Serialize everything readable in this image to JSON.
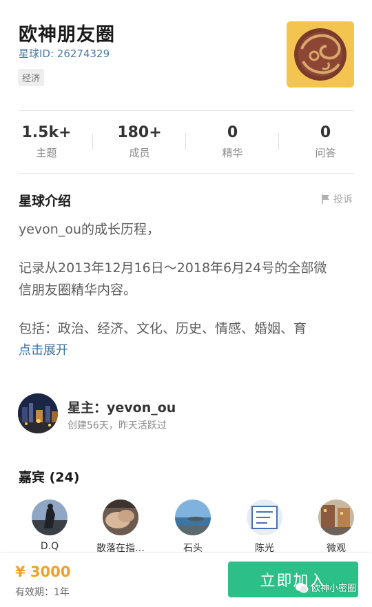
{
  "header": {
    "title": "欧神朋友圈",
    "planet_id": "星球ID: 26274329",
    "tag": "经济",
    "logo_icon": "dragon-jade-icon"
  },
  "stats": [
    {
      "value": "1.5k+",
      "label": "主题"
    },
    {
      "value": "180+",
      "label": "成员"
    },
    {
      "value": "0",
      "label": "精华"
    },
    {
      "value": "0",
      "label": "问答"
    }
  ],
  "intro": {
    "title": "星球介绍",
    "report_label": "投诉",
    "report_icon": "flag-icon",
    "lines": [
      "yevon_ou的成长历程，",
      "记录从2013年12月16日～2018年6月24号的全部微",
      "信朋友圈精华内容。",
      "包括：政治、经济、文化、历史、情感、婚姻、育"
    ],
    "expand_label": "点击展开"
  },
  "owner": {
    "name": "星主：yevon_ou",
    "subtitle": "创建56天，昨天活跃过"
  },
  "guests": {
    "title": "嘉宾 (24)",
    "items": [
      {
        "name": "D.Q"
      },
      {
        "name": "散落在指…"
      },
      {
        "name": "石头"
      },
      {
        "name": "陈光"
      },
      {
        "name": "微观"
      }
    ]
  },
  "footer": {
    "price": "¥ 3000",
    "validity": "有效期：1年",
    "join_label": "立即加入",
    "watermark": "欧神小密圈"
  },
  "colors": {
    "accent_green": "#2cbf88",
    "price_orange": "#f2a024",
    "link_blue": "#3b6e9e"
  }
}
